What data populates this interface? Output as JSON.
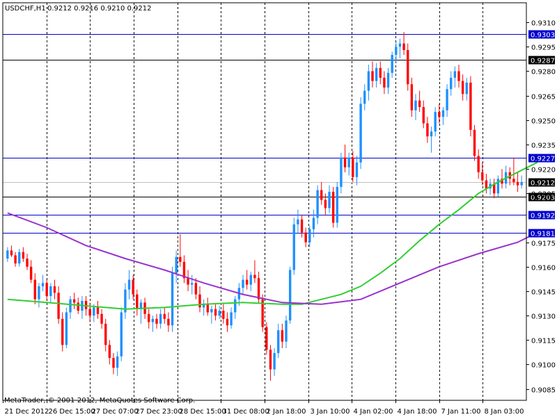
{
  "header": {
    "symbol": "USDCHF,H1",
    "ohlc": "0.9212 0.9216 0.9210 0.9212"
  },
  "footer": {
    "copyright": "MetaTrader, © 2001-2012, MetaQuotes Software Corp."
  },
  "colors": {
    "background": "#ffffff",
    "bull": "#1e90ff",
    "bear": "#ff0000",
    "ma_fast": "#32cd32",
    "ma_slow": "#9932cc",
    "level_line": "#0000cd",
    "grid": "#000000",
    "bid_line": "#c0c0c0"
  },
  "chart_data": {
    "type": "candlestick",
    "title": "USDCHF,H1",
    "ylim": [
      0.9078,
      0.9322
    ],
    "y_ticks": [
      "0.9310",
      "0.9295",
      "0.9280",
      "0.9265",
      "0.9250",
      "0.9235",
      "0.9220",
      "0.9205",
      "0.9175",
      "0.9160",
      "0.9145",
      "0.9130",
      "0.9115",
      "0.9100",
      "0.9085"
    ],
    "x_ticks": [
      "21 Dec 2012",
      "26 Dec 15:00",
      "27 Dec 07:00",
      "27 Dec 23:00",
      "28 Dec 15:00",
      "31 Dec 08:00",
      "2 Jan 18:00",
      "3 Jan 10:00",
      "4 Jan 02:00",
      "4 Jan 18:00",
      "7 Jan 11:00",
      "8 Jan 03:00"
    ],
    "vertical_grid_count": 12,
    "horizontal_levels": [
      {
        "label": "0.9303",
        "value": 0.9303,
        "color": "#0000cd"
      },
      {
        "label": "0.9287",
        "value": 0.9287,
        "color": "#000000"
      },
      {
        "label": "0.9227",
        "value": 0.9227,
        "color": "#0000cd"
      },
      {
        "label": "0.9203",
        "value": 0.9203,
        "color": "#000000"
      },
      {
        "label": "0.9192",
        "value": 0.9192,
        "color": "#0000cd"
      },
      {
        "label": "0.9181",
        "value": 0.9181,
        "color": "#0000cd"
      }
    ],
    "current_price": {
      "label": "0.9212",
      "value": 0.9212
    },
    "candles": [
      [
        0.9165,
        0.9172,
        0.9163,
        0.917
      ],
      [
        0.917,
        0.9173,
        0.9166,
        0.9167
      ],
      [
        0.9167,
        0.9169,
        0.916,
        0.9162
      ],
      [
        0.9162,
        0.9171,
        0.916,
        0.9169
      ],
      [
        0.9169,
        0.9172,
        0.9163,
        0.9165
      ],
      [
        0.9165,
        0.9168,
        0.9158,
        0.916
      ],
      [
        0.916,
        0.9164,
        0.915,
        0.9152
      ],
      [
        0.9152,
        0.9156,
        0.9137,
        0.914
      ],
      [
        0.914,
        0.915,
        0.9135,
        0.9148
      ],
      [
        0.9148,
        0.9155,
        0.9145,
        0.915
      ],
      [
        0.915,
        0.9152,
        0.914,
        0.9142
      ],
      [
        0.9142,
        0.915,
        0.9138,
        0.9148
      ],
      [
        0.9148,
        0.9152,
        0.914,
        0.9144
      ],
      [
        0.9144,
        0.9148,
        0.9125,
        0.9128
      ],
      [
        0.9128,
        0.9132,
        0.9108,
        0.9112
      ],
      [
        0.9112,
        0.9135,
        0.911,
        0.9132
      ],
      [
        0.9132,
        0.9142,
        0.9128,
        0.914
      ],
      [
        0.914,
        0.9144,
        0.9134,
        0.9138
      ],
      [
        0.9138,
        0.9141,
        0.9131,
        0.9133
      ],
      [
        0.9133,
        0.9142,
        0.9128,
        0.9139
      ],
      [
        0.9139,
        0.9142,
        0.913,
        0.9134
      ],
      [
        0.9134,
        0.9138,
        0.9126,
        0.913
      ],
      [
        0.913,
        0.9137,
        0.9126,
        0.9135
      ],
      [
        0.9135,
        0.9139,
        0.9128,
        0.9131
      ],
      [
        0.9131,
        0.9134,
        0.9122,
        0.9125
      ],
      [
        0.9125,
        0.9128,
        0.9108,
        0.9112
      ],
      [
        0.9112,
        0.9115,
        0.91,
        0.9104
      ],
      [
        0.9104,
        0.9107,
        0.9094,
        0.9098
      ],
      [
        0.9098,
        0.9108,
        0.9093,
        0.9105
      ],
      [
        0.9105,
        0.9135,
        0.9102,
        0.9132
      ],
      [
        0.9132,
        0.915,
        0.9128,
        0.9146
      ],
      [
        0.9146,
        0.9158,
        0.914,
        0.9152
      ],
      [
        0.9152,
        0.9155,
        0.914,
        0.9143
      ],
      [
        0.9143,
        0.9146,
        0.913,
        0.9134
      ],
      [
        0.9134,
        0.914,
        0.9125,
        0.9138
      ],
      [
        0.9138,
        0.9141,
        0.9128,
        0.9131
      ],
      [
        0.9131,
        0.9134,
        0.9122,
        0.9126
      ],
      [
        0.9126,
        0.913,
        0.912,
        0.9128
      ],
      [
        0.9128,
        0.9131,
        0.9122,
        0.9125
      ],
      [
        0.9125,
        0.9134,
        0.9122,
        0.9131
      ],
      [
        0.9131,
        0.9135,
        0.9125,
        0.9128
      ],
      [
        0.9128,
        0.9132,
        0.912,
        0.9124
      ],
      [
        0.9124,
        0.916,
        0.912,
        0.9156
      ],
      [
        0.9156,
        0.917,
        0.915,
        0.9166
      ],
      [
        0.9166,
        0.918,
        0.916,
        0.9163
      ],
      [
        0.9163,
        0.9167,
        0.915,
        0.9153
      ],
      [
        0.9153,
        0.9158,
        0.9145,
        0.9149
      ],
      [
        0.9149,
        0.9155,
        0.9143,
        0.915
      ],
      [
        0.915,
        0.9153,
        0.914,
        0.9143
      ],
      [
        0.9143,
        0.9148,
        0.9132,
        0.9135
      ],
      [
        0.9135,
        0.914,
        0.913,
        0.9137
      ],
      [
        0.9137,
        0.9141,
        0.913,
        0.9132
      ],
      [
        0.9132,
        0.9136,
        0.9125,
        0.9134
      ],
      [
        0.9134,
        0.9137,
        0.9127,
        0.913
      ],
      [
        0.913,
        0.9136,
        0.9128,
        0.9133
      ],
      [
        0.9133,
        0.9137,
        0.9125,
        0.9128
      ],
      [
        0.9128,
        0.9132,
        0.912,
        0.9124
      ],
      [
        0.9124,
        0.9135,
        0.9122,
        0.9132
      ],
      [
        0.9132,
        0.9142,
        0.9128,
        0.914
      ],
      [
        0.914,
        0.915,
        0.9136,
        0.9147
      ],
      [
        0.9147,
        0.9155,
        0.9143,
        0.9152
      ],
      [
        0.9152,
        0.9158,
        0.9146,
        0.9149
      ],
      [
        0.9149,
        0.9157,
        0.9145,
        0.9155
      ],
      [
        0.9155,
        0.9164,
        0.915,
        0.9153
      ],
      [
        0.9153,
        0.9157,
        0.9138,
        0.914
      ],
      [
        0.914,
        0.9143,
        0.912,
        0.9123
      ],
      [
        0.9123,
        0.9126,
        0.9106,
        0.9109
      ],
      [
        0.9109,
        0.9112,
        0.909,
        0.9097
      ],
      [
        0.9097,
        0.911,
        0.9093,
        0.9107
      ],
      [
        0.9107,
        0.9125,
        0.9104,
        0.9121
      ],
      [
        0.9121,
        0.9125,
        0.911,
        0.9114
      ],
      [
        0.9114,
        0.913,
        0.911,
        0.9127
      ],
      [
        0.9127,
        0.916,
        0.9125,
        0.9158
      ],
      [
        0.9158,
        0.919,
        0.9155,
        0.9186
      ],
      [
        0.9186,
        0.9195,
        0.918,
        0.9189
      ],
      [
        0.9189,
        0.9192,
        0.9178,
        0.9181
      ],
      [
        0.9181,
        0.9184,
        0.9172,
        0.9175
      ],
      [
        0.9175,
        0.9185,
        0.9172,
        0.9183
      ],
      [
        0.9183,
        0.9195,
        0.9178,
        0.919
      ],
      [
        0.919,
        0.921,
        0.9186,
        0.9207
      ],
      [
        0.9207,
        0.9212,
        0.9198,
        0.9201
      ],
      [
        0.9201,
        0.9205,
        0.9192,
        0.9196
      ],
      [
        0.9196,
        0.921,
        0.9193,
        0.9206
      ],
      [
        0.9206,
        0.9209,
        0.9184,
        0.9187
      ],
      [
        0.9187,
        0.9212,
        0.9184,
        0.9209
      ],
      [
        0.9209,
        0.923,
        0.9205,
        0.9227
      ],
      [
        0.9227,
        0.9235,
        0.9218,
        0.9221
      ],
      [
        0.9221,
        0.923,
        0.9216,
        0.9227
      ],
      [
        0.9227,
        0.9231,
        0.9212,
        0.9215
      ],
      [
        0.9215,
        0.9228,
        0.921,
        0.9224
      ],
      [
        0.9224,
        0.9264,
        0.922,
        0.926
      ],
      [
        0.926,
        0.9272,
        0.9256,
        0.9268
      ],
      [
        0.9268,
        0.9284,
        0.9262,
        0.928
      ],
      [
        0.928,
        0.9286,
        0.927,
        0.9274
      ],
      [
        0.9274,
        0.9285,
        0.927,
        0.9282
      ],
      [
        0.9282,
        0.9286,
        0.9272,
        0.9276
      ],
      [
        0.9276,
        0.928,
        0.9266,
        0.927
      ],
      [
        0.927,
        0.9282,
        0.9266,
        0.9279
      ],
      [
        0.9279,
        0.9292,
        0.9276,
        0.929
      ],
      [
        0.929,
        0.9298,
        0.9285,
        0.9295
      ],
      [
        0.9295,
        0.93,
        0.9288,
        0.9297
      ],
      [
        0.9297,
        0.9304,
        0.929,
        0.9293
      ],
      [
        0.9293,
        0.9297,
        0.9268,
        0.9272
      ],
      [
        0.9272,
        0.9276,
        0.9252,
        0.9256
      ],
      [
        0.9256,
        0.9266,
        0.925,
        0.9262
      ],
      [
        0.9262,
        0.9268,
        0.9255,
        0.9258
      ],
      [
        0.9258,
        0.9262,
        0.9245,
        0.9248
      ],
      [
        0.9248,
        0.9252,
        0.9236,
        0.924
      ],
      [
        0.924,
        0.9246,
        0.923,
        0.9243
      ],
      [
        0.9243,
        0.9258,
        0.924,
        0.9255
      ],
      [
        0.9255,
        0.926,
        0.9248,
        0.9252
      ],
      [
        0.9252,
        0.9258,
        0.9247,
        0.9256
      ],
      [
        0.9256,
        0.9272,
        0.9252,
        0.9269
      ],
      [
        0.9269,
        0.928,
        0.9265,
        0.9276
      ],
      [
        0.9276,
        0.9283,
        0.927,
        0.928
      ],
      [
        0.928,
        0.9284,
        0.927,
        0.9274
      ],
      [
        0.9274,
        0.9278,
        0.9262,
        0.9266
      ],
      [
        0.9266,
        0.9276,
        0.9262,
        0.9273
      ],
      [
        0.9273,
        0.9277,
        0.924,
        0.9244
      ],
      [
        0.9244,
        0.9247,
        0.9225,
        0.9228
      ],
      [
        0.9228,
        0.9232,
        0.9214,
        0.9218
      ],
      [
        0.9218,
        0.9224,
        0.921,
        0.9213
      ],
      [
        0.9213,
        0.9217,
        0.9205,
        0.9208
      ],
      [
        0.9208,
        0.9214,
        0.9204,
        0.9211
      ],
      [
        0.9211,
        0.9214,
        0.9202,
        0.9205
      ],
      [
        0.9205,
        0.9216,
        0.9203,
        0.9214
      ],
      [
        0.9214,
        0.922,
        0.9208,
        0.9211
      ],
      [
        0.9211,
        0.9222,
        0.9208,
        0.9218
      ],
      [
        0.9218,
        0.9221,
        0.921,
        0.9214
      ],
      [
        0.9214,
        0.9227,
        0.921,
        0.9212
      ],
      [
        0.9212,
        0.9218,
        0.9206,
        0.921
      ],
      [
        0.921,
        0.9216,
        0.9208,
        0.9212
      ]
    ],
    "series": [
      {
        "label": "",
        "color": "#32cd32",
        "points": [
          [
            0,
            0.914
          ],
          [
            10,
            0.9138
          ],
          [
            20,
            0.9136
          ],
          [
            30,
            0.9134
          ],
          [
            40,
            0.9135
          ],
          [
            50,
            0.9137
          ],
          [
            60,
            0.9138
          ],
          [
            70,
            0.9137
          ],
          [
            75,
            0.9137
          ],
          [
            80,
            0.914
          ],
          [
            85,
            0.9143
          ],
          [
            90,
            0.9148
          ],
          [
            95,
            0.9156
          ],
          [
            100,
            0.9165
          ],
          [
            105,
            0.9176
          ],
          [
            110,
            0.9186
          ],
          [
            115,
            0.9195
          ],
          [
            120,
            0.9205
          ],
          [
            125,
            0.9212
          ],
          [
            130,
            0.9218
          ],
          [
            135,
            0.9224
          ]
        ]
      },
      {
        "label": "",
        "color": "#9932cc",
        "points": [
          [
            0,
            0.9193
          ],
          [
            10,
            0.9184
          ],
          [
            20,
            0.9173
          ],
          [
            30,
            0.9165
          ],
          [
            40,
            0.9158
          ],
          [
            50,
            0.915
          ],
          [
            60,
            0.9143
          ],
          [
            70,
            0.9138
          ],
          [
            80,
            0.9137
          ],
          [
            90,
            0.914
          ],
          [
            100,
            0.915
          ],
          [
            110,
            0.916
          ],
          [
            120,
            0.9168
          ],
          [
            130,
            0.9175
          ],
          [
            135,
            0.9181
          ]
        ]
      }
    ]
  }
}
